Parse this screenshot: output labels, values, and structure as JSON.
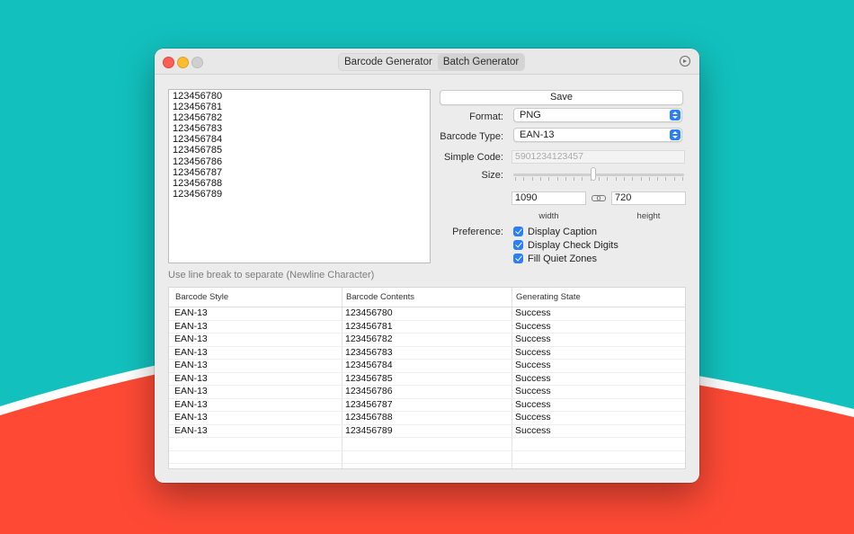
{
  "colors": {
    "background_top": "#12c1bd",
    "background_bottom": "#fe4a35",
    "accent": "#2a7ff6"
  },
  "titlebar": {
    "tabs": [
      {
        "label": "Barcode Generator",
        "active": false
      },
      {
        "label": "Batch Generator",
        "active": true
      }
    ],
    "settings_icon": "play-circle-icon"
  },
  "input": {
    "codes": [
      "123456780",
      "123456781",
      "123456782",
      "123456783",
      "123456784",
      "123456785",
      "123456786",
      "123456787",
      "123456788",
      "123456789"
    ],
    "hint": "Use line break to separate (Newline Character)"
  },
  "options": {
    "save_label": "Save",
    "format_label": "Format:",
    "format_value": "PNG",
    "type_label": "Barcode Type:",
    "type_value": "EAN-13",
    "simple_code_label": "Simple Code:",
    "simple_code_placeholder": "5901234123457",
    "size_label": "Size:",
    "width_value": "1090",
    "height_value": "720",
    "width_label": "width",
    "height_label": "height",
    "preference_label": "Preference:",
    "preferences": [
      {
        "label": "Display Caption",
        "checked": true
      },
      {
        "label": "Display Check Digits",
        "checked": true
      },
      {
        "label": "Fill Quiet Zones",
        "checked": true
      }
    ]
  },
  "table": {
    "headers": [
      "Barcode Style",
      "Barcode Contents",
      "Generating State"
    ],
    "rows": [
      [
        "EAN-13",
        "123456780",
        "Success"
      ],
      [
        "EAN-13",
        "123456781",
        "Success"
      ],
      [
        "EAN-13",
        "123456782",
        "Success"
      ],
      [
        "EAN-13",
        "123456783",
        "Success"
      ],
      [
        "EAN-13",
        "123456784",
        "Success"
      ],
      [
        "EAN-13",
        "123456785",
        "Success"
      ],
      [
        "EAN-13",
        "123456786",
        "Success"
      ],
      [
        "EAN-13",
        "123456787",
        "Success"
      ],
      [
        "EAN-13",
        "123456788",
        "Success"
      ],
      [
        "EAN-13",
        "123456789",
        "Success"
      ]
    ]
  }
}
